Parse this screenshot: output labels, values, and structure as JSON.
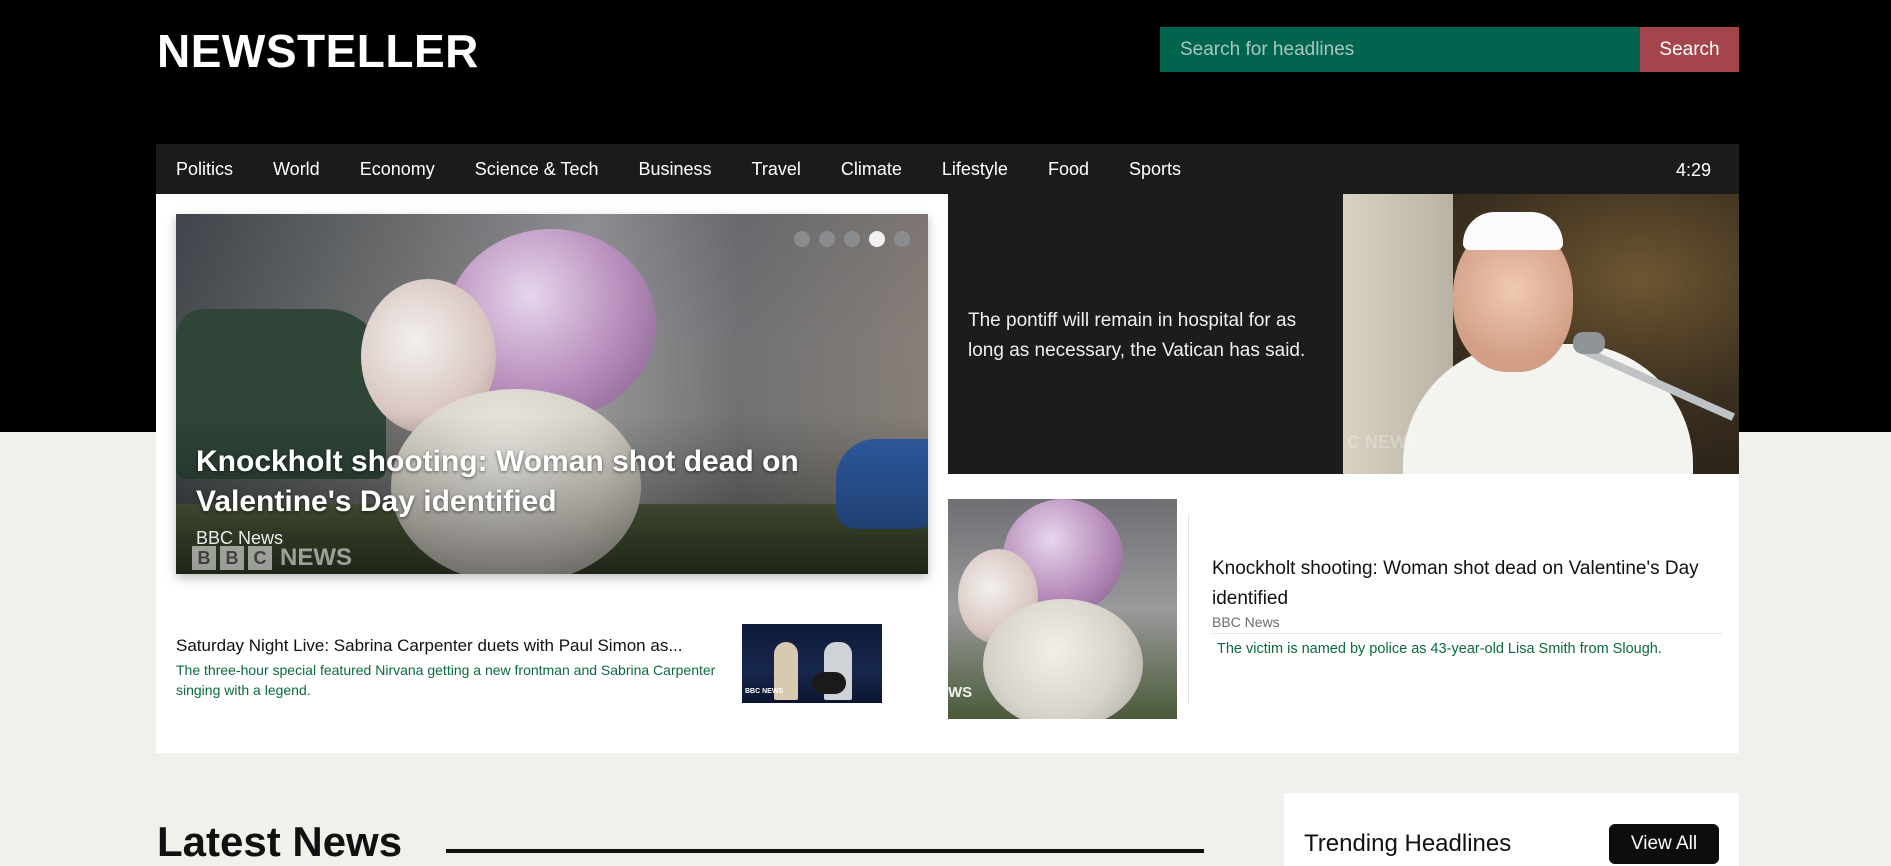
{
  "header": {
    "logo": "NEWSTELLER",
    "search": {
      "placeholder": "Search for headlines",
      "button_label": "Search"
    }
  },
  "nav": {
    "items": [
      "Politics",
      "World",
      "Economy",
      "Science & Tech",
      "Business",
      "Travel",
      "Climate",
      "Lifestyle",
      "Food",
      "Sports"
    ],
    "clock": "4:29"
  },
  "carousel": {
    "title": "Knockholt shooting: Woman shot dead on Valentine's Day identified",
    "source": "BBC News",
    "watermark": "NEWS",
    "slide_count": 5,
    "active_slide": 4
  },
  "feature": {
    "text": "The pontiff will remain in hospital for as long as necessary, the Vatican has said.",
    "watermark": "C NEWS"
  },
  "mini_article": {
    "title": "Saturday Night Live: Sabrina Carpenter duets with Paul Simon as...",
    "description": "The three-hour special featured Nirvana getting a new frontman and Sabrina Carpenter singing with a legend.",
    "thumb_mark": "BBC NEWS"
  },
  "story_card": {
    "title": "Knockholt shooting: Woman shot dead on Valentine's Day identified",
    "source": "BBC News",
    "description": "The victim is named by police as 43-year-old Lisa Smith from Slough.",
    "image_mark": "WS"
  },
  "sections": {
    "latest_title": "Latest News",
    "trending_title": "Trending Headlines",
    "view_all_label": "View All"
  },
  "colors": {
    "search_bg": "#00644f",
    "search_button": "#a3454a",
    "accent_text": "#0b6b3c"
  }
}
